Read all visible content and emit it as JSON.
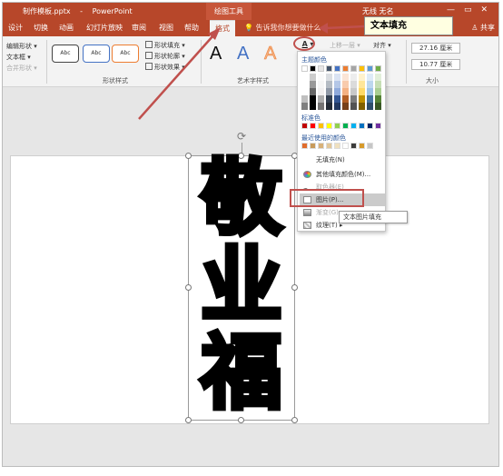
{
  "titlebar": {
    "filename": "制作模板.pptx",
    "separator": "-",
    "app": "PowerPoint",
    "context_tool": "绘图工具",
    "user": "无线 无名",
    "win_min": "—",
    "win_restore": "▭",
    "win_close": "✕"
  },
  "tabs": {
    "items": [
      "设计",
      "切换",
      "动画",
      "幻灯片放映",
      "审阅",
      "视图",
      "帮助"
    ],
    "active": "格式",
    "tellme": "告诉我你想要做什么",
    "share": "共享"
  },
  "ribbon": {
    "left_items": [
      "编辑形状 ▾",
      "文本框 ▾",
      "合并形状 ▾"
    ],
    "shape_style_label": "Abc",
    "shape_opts": [
      "形状填充 ▾",
      "形状轮廓 ▾",
      "形状效果 ▾"
    ],
    "group_shape_styles": "形状样式",
    "wordart_letter": "A",
    "group_wordart": "艺术字样式",
    "bring_forward": "上移一层 ▾",
    "align": "对齐 ▾",
    "height_value": "27.16 厘米",
    "width_value": "10.77 厘米",
    "group_size": "大小"
  },
  "callout": {
    "text": "文本填充"
  },
  "dropdown": {
    "theme_colors_heading": "主题颜色",
    "standard_colors_heading": "标准色",
    "recent_colors_heading": "最近使用的颜色",
    "items": {
      "no_fill": "无填充(N)",
      "more_colors": "其他填充颜色(M)...",
      "eyedropper": "取色器(E)",
      "picture": "图片(P)...",
      "gradient": "渐变(G)",
      "texture": "纹理(T)"
    },
    "submenu_tooltip": "文本图片填充",
    "theme_top_row": [
      "#ffffff",
      "#000000",
      "#e7e6e6",
      "#44546a",
      "#4472c4",
      "#ed7d31",
      "#a5a5a5",
      "#ffc000",
      "#5b9bd5",
      "#70ad47"
    ],
    "standard_colors": [
      "#c00000",
      "#ff0000",
      "#ffc000",
      "#ffff00",
      "#92d050",
      "#00b050",
      "#00b0f0",
      "#0070c0",
      "#002060",
      "#7030a0"
    ],
    "recent_colors": [
      "#e06c2c",
      "#c79a5b",
      "#d8b179",
      "#e2c79a",
      "#efe0bf",
      "#ffffff",
      "#3b3b3b",
      "#d79a2a",
      "#c6c6c6"
    ]
  },
  "slide": {
    "chars": [
      "敬",
      "业",
      "福"
    ]
  },
  "colors": {
    "accent": "#b7472a",
    "highlight_red": "#c0504d"
  }
}
